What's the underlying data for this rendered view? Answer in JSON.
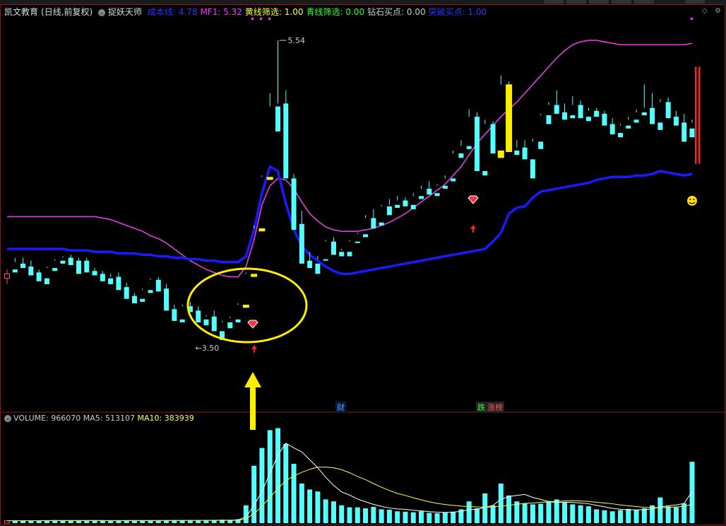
{
  "header": {
    "stock_name": "凯文教育",
    "period": "(日线,前复权)",
    "indicator_name": "捉妖天师",
    "items": [
      {
        "label": "成本线:",
        "value": "4.78",
        "color": "#3333ff"
      },
      {
        "label": "MF1:",
        "value": "5.32",
        "color": "#ff33ff"
      },
      {
        "label": "黄线筛选:",
        "value": "1.00",
        "color": "#ffff33"
      },
      {
        "label": "青线筛选:",
        "value": "0.00",
        "color": "#33ff33"
      },
      {
        "label": "钻石买点:",
        "value": "0.00",
        "color": "#cccccc"
      },
      {
        "label": "突破买点:",
        "value": "1.00",
        "color": "#3333ff"
      }
    ]
  },
  "volume_header": {
    "label": "VOLUME:",
    "value": "966070",
    "ma5_label": "MA5:",
    "ma5_value": "513107",
    "ma10_label": "MA10:",
    "ma10_value": "383939"
  },
  "markers": {
    "high_label": "5.54",
    "low_label": "3.50",
    "finance_tag": "财",
    "rank_tag_1": "跌",
    "rank_tag_2": "涨榜"
  },
  "colors": {
    "up": "#ff5555",
    "down": "#55ffff",
    "upper_band": "#e040e0",
    "cost_line": "#1a1aff",
    "highlight": "#ffee00",
    "ma5": "#ffffff",
    "ma10": "#ffff55",
    "background": "#000000"
  },
  "chart_data": {
    "type": "candlestick",
    "title": "凯文教育 日线",
    "price_labels": {
      "high": 5.54,
      "low": 3.5
    },
    "candles": [
      [
        3.92,
        3.98,
        3.95,
        3.88
      ],
      [
        3.98,
        4.06,
        3.96,
        4.03
      ],
      [
        4.02,
        4.06,
        3.99,
        4.0
      ],
      [
        4.0,
        4.04,
        3.94,
        3.96
      ],
      [
        3.96,
        3.98,
        3.9,
        3.92
      ],
      [
        3.92,
        4.0,
        3.88,
        3.99
      ],
      [
        3.99,
        4.05,
        3.97,
        4.04
      ],
      [
        4.04,
        4.07,
        4.02,
        4.06
      ],
      [
        4.06,
        4.08,
        4.01,
        4.03
      ],
      [
        4.04,
        4.06,
        3.95,
        4.04
      ],
      [
        4.04,
        4.06,
        3.96,
        3.97
      ],
      [
        3.97,
        3.99,
        3.94,
        3.95
      ],
      [
        3.95,
        3.97,
        3.9,
        3.92
      ],
      [
        3.92,
        3.95,
        3.88,
        3.93
      ],
      [
        3.93,
        3.96,
        3.84,
        3.86
      ],
      [
        3.86,
        3.89,
        3.78,
        3.8
      ],
      [
        3.8,
        3.82,
        3.75,
        3.78
      ],
      [
        3.78,
        3.85,
        3.76,
        3.84
      ],
      [
        3.84,
        3.92,
        3.82,
        3.91
      ],
      [
        3.91,
        3.93,
        3.83,
        3.85
      ],
      [
        3.85,
        3.88,
        3.7,
        3.71
      ],
      [
        3.71,
        3.74,
        3.63,
        3.64
      ],
      [
        3.64,
        3.74,
        3.62,
        3.73
      ],
      [
        3.73,
        3.76,
        3.69,
        3.7
      ],
      [
        3.7,
        3.73,
        3.62,
        3.64
      ],
      [
        3.64,
        3.67,
        3.6,
        3.66
      ],
      [
        3.66,
        3.7,
        3.56,
        3.56
      ],
      [
        3.56,
        3.63,
        3.5,
        3.62
      ],
      [
        3.62,
        3.66,
        3.58,
        3.65
      ],
      [
        3.64,
        3.75,
        3.62,
        3.74
      ],
      [
        3.74,
        3.96,
        3.72,
        3.95
      ],
      [
        3.95,
        4.28,
        3.93,
        4.26
      ],
      [
        4.26,
        4.62,
        4.24,
        4.61
      ],
      [
        4.61,
        5.18,
        4.59,
        5.09
      ],
      [
        5.09,
        5.54,
        4.92,
        5.11
      ],
      [
        5.11,
        5.2,
        4.6,
        4.6
      ],
      [
        4.6,
        4.63,
        4.25,
        4.29
      ],
      [
        4.29,
        4.38,
        4.02,
        4.04
      ],
      [
        4.04,
        4.1,
        3.99,
        4.02
      ],
      [
        4.02,
        4.07,
        3.95,
        4.05
      ],
      [
        4.05,
        4.18,
        4.04,
        4.17
      ],
      [
        4.17,
        4.2,
        4.08,
        4.1
      ],
      [
        4.1,
        4.12,
        4.07,
        4.11
      ],
      [
        4.1,
        4.18,
        4.07,
        4.17
      ],
      [
        4.17,
        4.23,
        4.16,
        4.22
      ],
      [
        4.22,
        4.35,
        4.2,
        4.33
      ],
      [
        4.33,
        4.39,
        4.26,
        4.3
      ],
      [
        4.3,
        4.42,
        4.28,
        4.41
      ],
      [
        4.41,
        4.46,
        4.35,
        4.42
      ],
      [
        4.42,
        4.48,
        4.4,
        4.45
      ],
      [
        4.45,
        4.47,
        4.41,
        4.42
      ],
      [
        4.42,
        4.5,
        4.39,
        4.48
      ],
      [
        4.48,
        4.55,
        4.46,
        4.53
      ],
      [
        4.53,
        4.58,
        4.49,
        4.5
      ],
      [
        4.5,
        4.56,
        4.48,
        4.55
      ],
      [
        4.55,
        4.62,
        4.53,
        4.6
      ],
      [
        4.6,
        4.79,
        4.58,
        4.77
      ],
      [
        4.77,
        4.86,
        4.74,
        4.82
      ],
      [
        4.82,
        5.07,
        4.8,
        5.02
      ],
      [
        5.02,
        5.05,
        4.65,
        4.65
      ],
      [
        4.65,
        5.0,
        4.62,
        4.97
      ],
      [
        4.97,
        4.99,
        4.77,
        4.77
      ],
      [
        4.79,
        5.3,
        4.74,
        5.24
      ],
      [
        5.24,
        5.26,
        4.78,
        4.79
      ],
      [
        4.79,
        4.86,
        4.76,
        4.81
      ],
      [
        4.81,
        4.86,
        4.73,
        4.73
      ],
      [
        4.73,
        4.87,
        4.6,
        4.85
      ],
      [
        4.85,
        5.04,
        4.8,
        5.03
      ],
      [
        5.03,
        5.12,
        4.97,
        5.1
      ],
      [
        5.1,
        5.2,
        5.04,
        5.05
      ],
      [
        5.05,
        5.11,
        5.0,
        5.03
      ],
      [
        5.03,
        5.16,
        5.01,
        5.1
      ],
      [
        5.1,
        5.13,
        5.01,
        5.02
      ],
      [
        5.02,
        5.08,
        4.99,
        5.06
      ],
      [
        5.06,
        5.08,
        5.02,
        5.04
      ],
      [
        5.04,
        5.06,
        4.96,
        4.97
      ],
      [
        4.97,
        5.01,
        4.9,
        4.91
      ],
      [
        4.91,
        4.97,
        4.88,
        4.96
      ],
      [
        4.96,
        5.02,
        4.94,
        5.0
      ],
      [
        5.0,
        5.07,
        4.98,
        5.05
      ],
      [
        5.05,
        5.24,
        5.03,
        5.08
      ],
      [
        5.08,
        5.18,
        4.97,
        4.98
      ],
      [
        4.98,
        5.14,
        4.93,
        5.12
      ],
      [
        5.12,
        5.15,
        5.01,
        5.02
      ],
      [
        5.02,
        5.06,
        4.96,
        4.98
      ],
      [
        4.98,
        5.04,
        4.85,
        4.94
      ],
      [
        4.94,
        5.0,
        4.88,
        4.98
      ]
    ],
    "upper_band": [
      4.34,
      4.34,
      4.34,
      4.34,
      4.34,
      4.34,
      4.34,
      4.34,
      4.34,
      4.34,
      4.34,
      4.34,
      4.33,
      4.32,
      4.3,
      4.28,
      4.26,
      4.24,
      4.21,
      4.19,
      4.16,
      4.12,
      4.08,
      4.04,
      4.01,
      3.98,
      3.96,
      3.94,
      3.93,
      3.93,
      4.0,
      4.18,
      4.42,
      4.55,
      4.6,
      4.59,
      4.53,
      4.44,
      4.36,
      4.31,
      4.27,
      4.25,
      4.24,
      4.24,
      4.24,
      4.25,
      4.26,
      4.28,
      4.3,
      4.33,
      4.36,
      4.4,
      4.44,
      4.48,
      4.52,
      4.56,
      4.62,
      4.68,
      4.76,
      4.84,
      4.9,
      4.96,
      5.02,
      5.07,
      5.12,
      5.18,
      5.24,
      5.3,
      5.36,
      5.42,
      5.47,
      5.51,
      5.53,
      5.54,
      5.54,
      5.53,
      5.52,
      5.51,
      5.51,
      5.51,
      5.51,
      5.51,
      5.51,
      5.51,
      5.51,
      5.51,
      5.52
    ],
    "cost_line": [
      4.12,
      4.12,
      4.12,
      4.12,
      4.12,
      4.12,
      4.12,
      4.12,
      4.11,
      4.11,
      4.11,
      4.1,
      4.1,
      4.1,
      4.09,
      4.09,
      4.09,
      4.08,
      4.08,
      4.07,
      4.07,
      4.06,
      4.06,
      4.05,
      4.05,
      4.04,
      4.04,
      4.03,
      4.03,
      4.03,
      4.07,
      4.25,
      4.5,
      4.68,
      4.65,
      4.43,
      4.25,
      4.14,
      4.08,
      4.04,
      4.0,
      3.97,
      3.95,
      3.95,
      3.96,
      3.97,
      3.98,
      3.99,
      4.0,
      4.01,
      4.02,
      4.03,
      4.04,
      4.05,
      4.06,
      4.07,
      4.08,
      4.09,
      4.1,
      4.11,
      4.12,
      4.17,
      4.23,
      4.36,
      4.4,
      4.41,
      4.47,
      4.51,
      4.52,
      4.53,
      4.54,
      4.55,
      4.56,
      4.57,
      4.59,
      4.6,
      4.61,
      4.61,
      4.61,
      4.62,
      4.62,
      4.63,
      4.65,
      4.64,
      4.63,
      4.62,
      4.63
    ],
    "highlight_indices": [
      30,
      31,
      32,
      33,
      62,
      63
    ],
    "volume": [
      12000,
      13000,
      11000,
      14000,
      12000,
      13500,
      15000,
      14000,
      13000,
      12500,
      13000,
      14500,
      12000,
      11500,
      13000,
      15000,
      14000,
      13500,
      12000,
      11000,
      14000,
      16000,
      13000,
      12000,
      14500,
      13000,
      15500,
      17000,
      16000,
      20000,
      90000,
      290000,
      380000,
      470000,
      480000,
      400000,
      300000,
      200000,
      170000,
      160000,
      120000,
      110000,
      90000,
      80000,
      80000,
      75000,
      82000,
      70000,
      68000,
      60000,
      58000,
      55000,
      60000,
      52000,
      50000,
      54000,
      58000,
      70000,
      110000,
      75000,
      150000,
      90000,
      200000,
      140000,
      110000,
      100000,
      95000,
      98000,
      112000,
      120000,
      105000,
      95000,
      90000,
      85000,
      70000,
      65000,
      60000,
      66000,
      72000,
      68000,
      75000,
      90000,
      130000,
      85000,
      80000,
      100000,
      310000
    ],
    "ma5": [
      12500,
      12600,
      12500,
      12700,
      12800,
      13000,
      13200,
      13300,
      13400,
      13600,
      13500,
      13300,
      13100,
      12900,
      12800,
      13100,
      13200,
      13400,
      13400,
      13200,
      13300,
      13800,
      14100,
      14300,
      14400,
      14500,
      14700,
      15000,
      15100,
      16200,
      31700,
      88700,
      160700,
      250000,
      344000,
      404000,
      380000,
      360000,
      320000,
      280000,
      232000,
      191000,
      158000,
      142000,
      122000,
      108000,
      95000,
      85000,
      77000,
      72000,
      70000,
      65000,
      62000,
      58000,
      56000,
      54000,
      56000,
      60000,
      68000,
      70000,
      80000,
      90000,
      120000,
      135000,
      140000,
      145000,
      130000,
      120000,
      108000,
      105000,
      106000,
      105000,
      102000,
      98000,
      90000,
      82000,
      75000,
      70000,
      68000,
      67000,
      68000,
      72000,
      82000,
      88000,
      92000,
      100000,
      160000
    ],
    "ma10": [
      12300,
      12400,
      12500,
      12600,
      12700,
      12800,
      12900,
      13000,
      13050,
      13100,
      13150,
      13200,
      13200,
      13150,
      13100,
      13100,
      13100,
      13150,
      13200,
      13250,
      13300,
      13400,
      13500,
      13600,
      13700,
      13800,
      14000,
      14200,
      14400,
      14800,
      22000,
      48000,
      85000,
      130000,
      175000,
      215000,
      238000,
      257000,
      272000,
      283000,
      283000,
      280000,
      270000,
      255000,
      236000,
      220000,
      200000,
      182000,
      165000,
      150000,
      140000,
      128000,
      118000,
      108000,
      100000,
      94000,
      90000,
      86000,
      84000,
      82000,
      80000,
      82000,
      86000,
      90000,
      95000,
      100000,
      102000,
      105000,
      108000,
      110000,
      112000,
      114000,
      112000,
      110000,
      106000,
      102000,
      98000,
      92000,
      88000,
      84000,
      80000,
      78000,
      78000,
      80000,
      82000,
      85000,
      95000
    ],
    "ylim_price": [
      3.36,
      5.68
    ],
    "ylim_volume": [
      0,
      500000
    ]
  }
}
